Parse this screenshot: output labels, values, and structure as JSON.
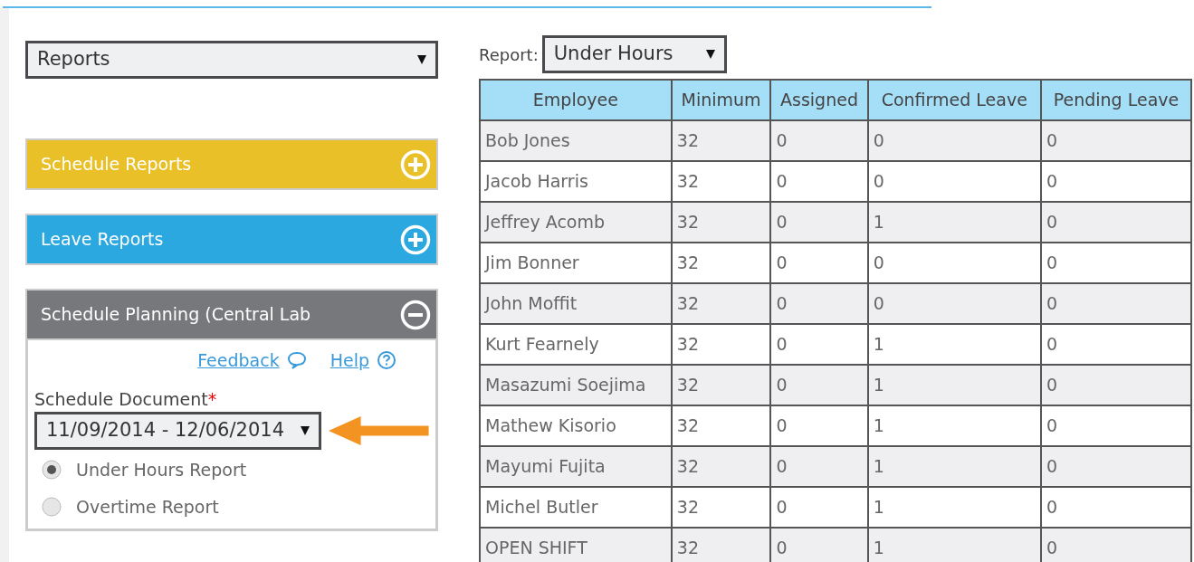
{
  "menu_select": {
    "value": "Reports"
  },
  "panels": [
    {
      "title": "Schedule Reports",
      "color": "#e9c027",
      "expanded": false
    },
    {
      "title": "Leave Reports",
      "color": "#2ca8e0",
      "expanded": false
    },
    {
      "title": "Schedule Planning (Central Lab",
      "color": "#77787b",
      "expanded": true
    }
  ],
  "planning": {
    "links": [
      "Feedback",
      "Help"
    ],
    "field_label": "Schedule Document",
    "required": "*",
    "document_select": {
      "value": "11/09/2014 - 12/06/2014"
    },
    "options": [
      {
        "label": "Under Hours Report",
        "selected": true
      },
      {
        "label": "Overtime Report",
        "selected": false
      }
    ]
  },
  "report": {
    "label": "Report:",
    "value": "Under Hours"
  },
  "table": {
    "columns": [
      "Employee",
      "Minimum",
      "Assigned",
      "Confirmed Leave",
      "Pending Leave"
    ],
    "rows": [
      [
        "Bob Jones",
        "32",
        "0",
        "0",
        "0"
      ],
      [
        "Jacob Harris",
        "32",
        "0",
        "0",
        "0"
      ],
      [
        "Jeffrey Acomb",
        "32",
        "0",
        "1",
        "0"
      ],
      [
        "Jim Bonner",
        "32",
        "0",
        "0",
        "0"
      ],
      [
        "John Moffit",
        "32",
        "0",
        "0",
        "0"
      ],
      [
        "Kurt Fearnely",
        "32",
        "0",
        "1",
        "0"
      ],
      [
        "Masazumi Soejima",
        "32",
        "0",
        "1",
        "0"
      ],
      [
        "Mathew Kisorio",
        "32",
        "0",
        "1",
        "0"
      ],
      [
        "Mayumi Fujita",
        "32",
        "0",
        "1",
        "0"
      ],
      [
        "Michel Butler",
        "32",
        "0",
        "1",
        "0"
      ],
      [
        "OPEN SHIFT",
        "32",
        "0",
        "1",
        "0"
      ]
    ]
  }
}
